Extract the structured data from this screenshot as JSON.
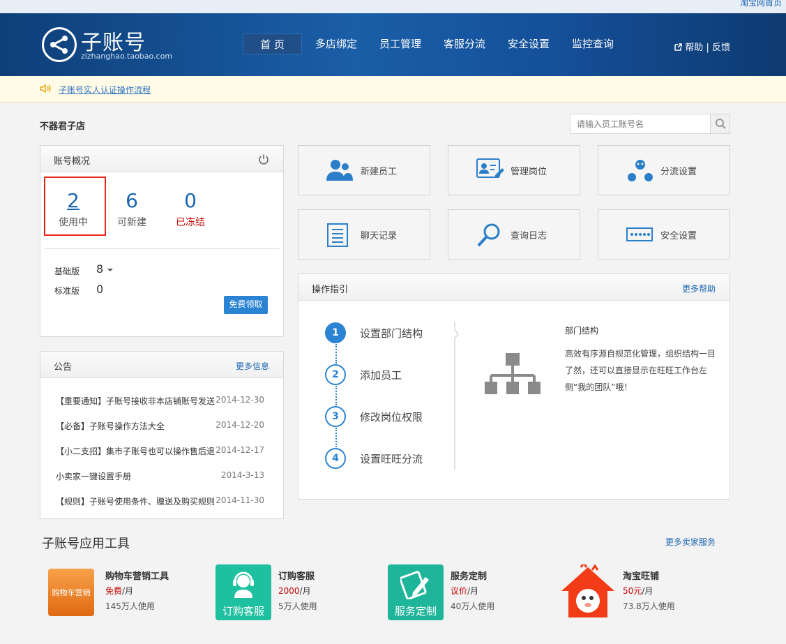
{
  "topbar": {
    "link": "淘宝网首页"
  },
  "header": {
    "title": "子账号",
    "subtitle": "zizhanghao.taobao.com",
    "help": "帮助",
    "sep": "|",
    "feedback": "反馈",
    "nav": [
      "首 页",
      "多店绑定",
      "员工管理",
      "客服分流",
      "安全设置",
      "监控查询"
    ]
  },
  "notice": {
    "text": "子账号实人认证操作流程"
  },
  "shop": {
    "name": "不器君子店"
  },
  "search": {
    "placeholder": "请输入员工账号名"
  },
  "account": {
    "title": "账号概况",
    "stats": [
      {
        "value": "2",
        "label": "使用中"
      },
      {
        "value": "6",
        "label": "可新建"
      },
      {
        "value": "0",
        "label": "已冻结"
      }
    ],
    "basic_label": "基础版",
    "basic_value": "8",
    "standard_label": "标准版",
    "standard_value": "0",
    "free_btn": "免费领取"
  },
  "announce": {
    "title": "公告",
    "more": "更多信息",
    "items": [
      {
        "text": "【重要通知】子账号接收非本店铺账号发送",
        "date": "2014-12-30"
      },
      {
        "text": "【必备】子账号操作方法大全",
        "date": "2014-12-20"
      },
      {
        "text": "【小二支招】集市子账号也可以操作售后退",
        "date": "2014-12-17"
      },
      {
        "text": "小卖家一键设置手册",
        "date": "2014-3-13"
      },
      {
        "text": "【规则】子账号使用条件、赠送及购买规则",
        "date": "2014-11-30"
      }
    ]
  },
  "tiles": [
    "新建员工",
    "管理岗位",
    "分流设置",
    "聊天记录",
    "查询日志",
    "安全设置"
  ],
  "guide": {
    "title": "操作指引",
    "more": "更多帮助",
    "steps": [
      {
        "n": "1",
        "t": "设置部门结构"
      },
      {
        "n": "2",
        "t": "添加员工"
      },
      {
        "n": "3",
        "t": "修改岗位权限"
      },
      {
        "n": "4",
        "t": "设置旺旺分流"
      }
    ],
    "detail_title": "部门结构",
    "detail_lines": [
      "高效有序源自规范化管理，组织结构一目",
      "了然，还可以直接显示在旺旺工作台左",
      "侧“我的团队”哦！"
    ]
  },
  "tools": {
    "title": "子账号应用工具",
    "more": "更多卖家服务",
    "items": [
      {
        "name": "购物车营销工具",
        "price": "免费",
        "unit": "/月",
        "users": "145万人使用",
        "icon_text": "购物车营销"
      },
      {
        "name": "订购客服",
        "price": "2000",
        "unit": "/月",
        "users": "5万人使用",
        "icon_text": "订购客服"
      },
      {
        "name": "服务定制",
        "price": "议价",
        "unit": "/月",
        "users": "40万人使用",
        "icon_text": "服务定制"
      },
      {
        "name": "淘宝旺铺",
        "price": "50元",
        "unit": "/月",
        "users": "73.8万人使用",
        "icon_text": ""
      }
    ]
  }
}
